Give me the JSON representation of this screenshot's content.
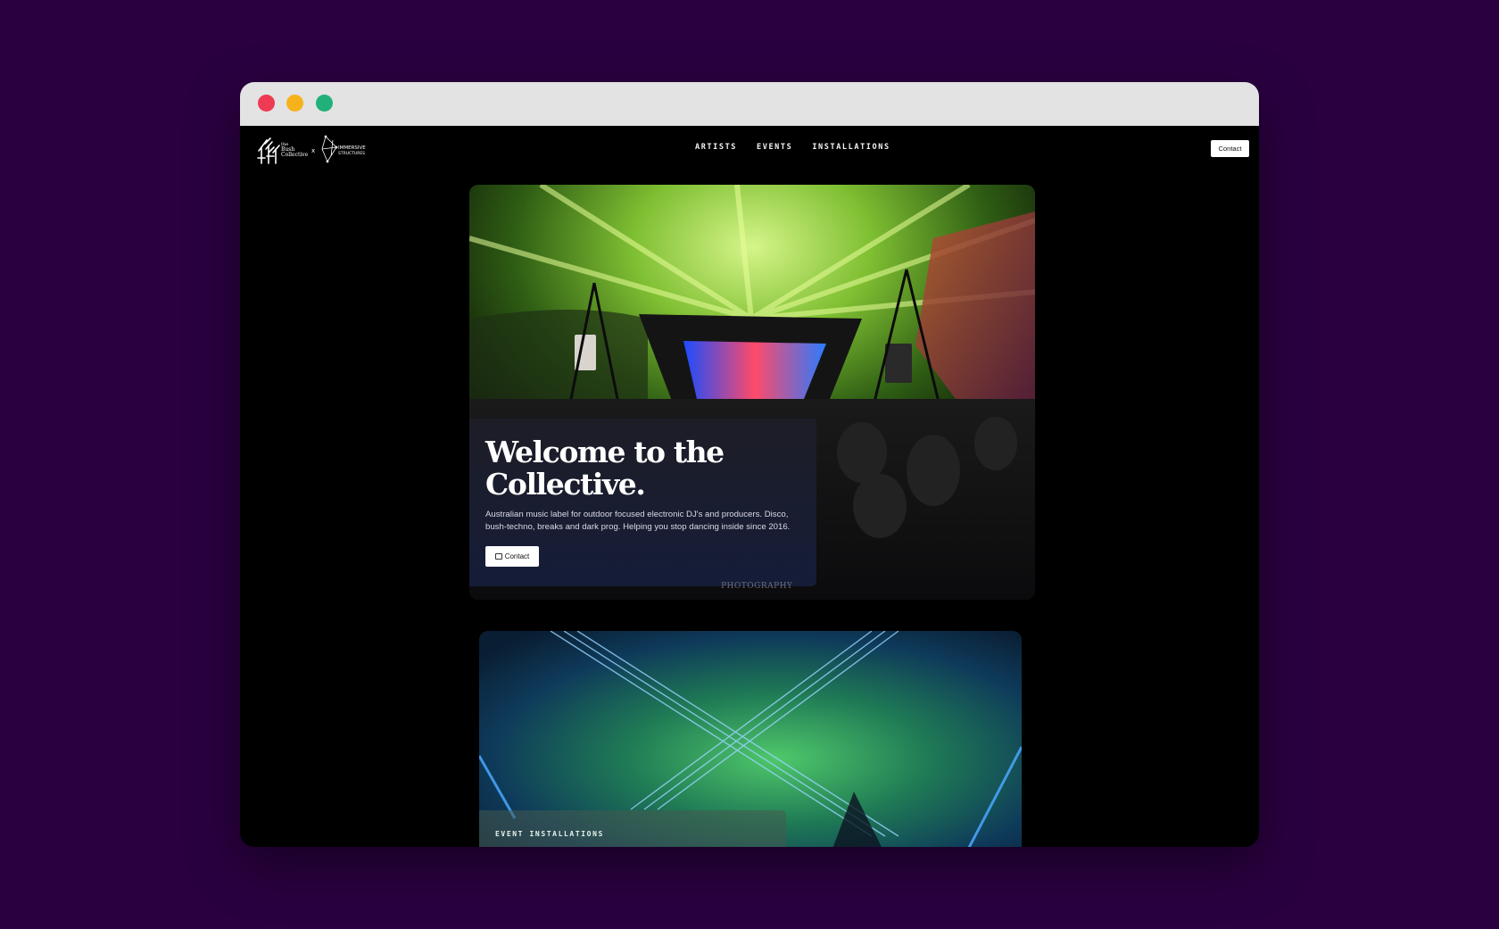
{
  "window": {
    "controls": [
      "close",
      "minimize",
      "maximize"
    ]
  },
  "nav": {
    "logo_alt": "The Bush Collective x Immersive Structures",
    "links": [
      "ARTISTS",
      "EVENTS",
      "INSTALLATIONS"
    ],
    "contact_label": "Contact"
  },
  "hero": {
    "title": "Welcome to the Collective.",
    "description": "Australian music label for outdoor focused electronic DJ's and producers. Disco, bush-techno, breaks and dark prog. Helping you stop dancing inside since 2016.",
    "button_label": "Contact",
    "watermark": "PHOTOGRAPHY"
  },
  "installations": {
    "label": "EVENT INSTALLATIONS"
  },
  "colors": {
    "backdrop": "#2a0040",
    "site_bg": "#000000",
    "close": "#ee3a53",
    "minimize": "#f6b21c",
    "maximize": "#22b07a"
  }
}
